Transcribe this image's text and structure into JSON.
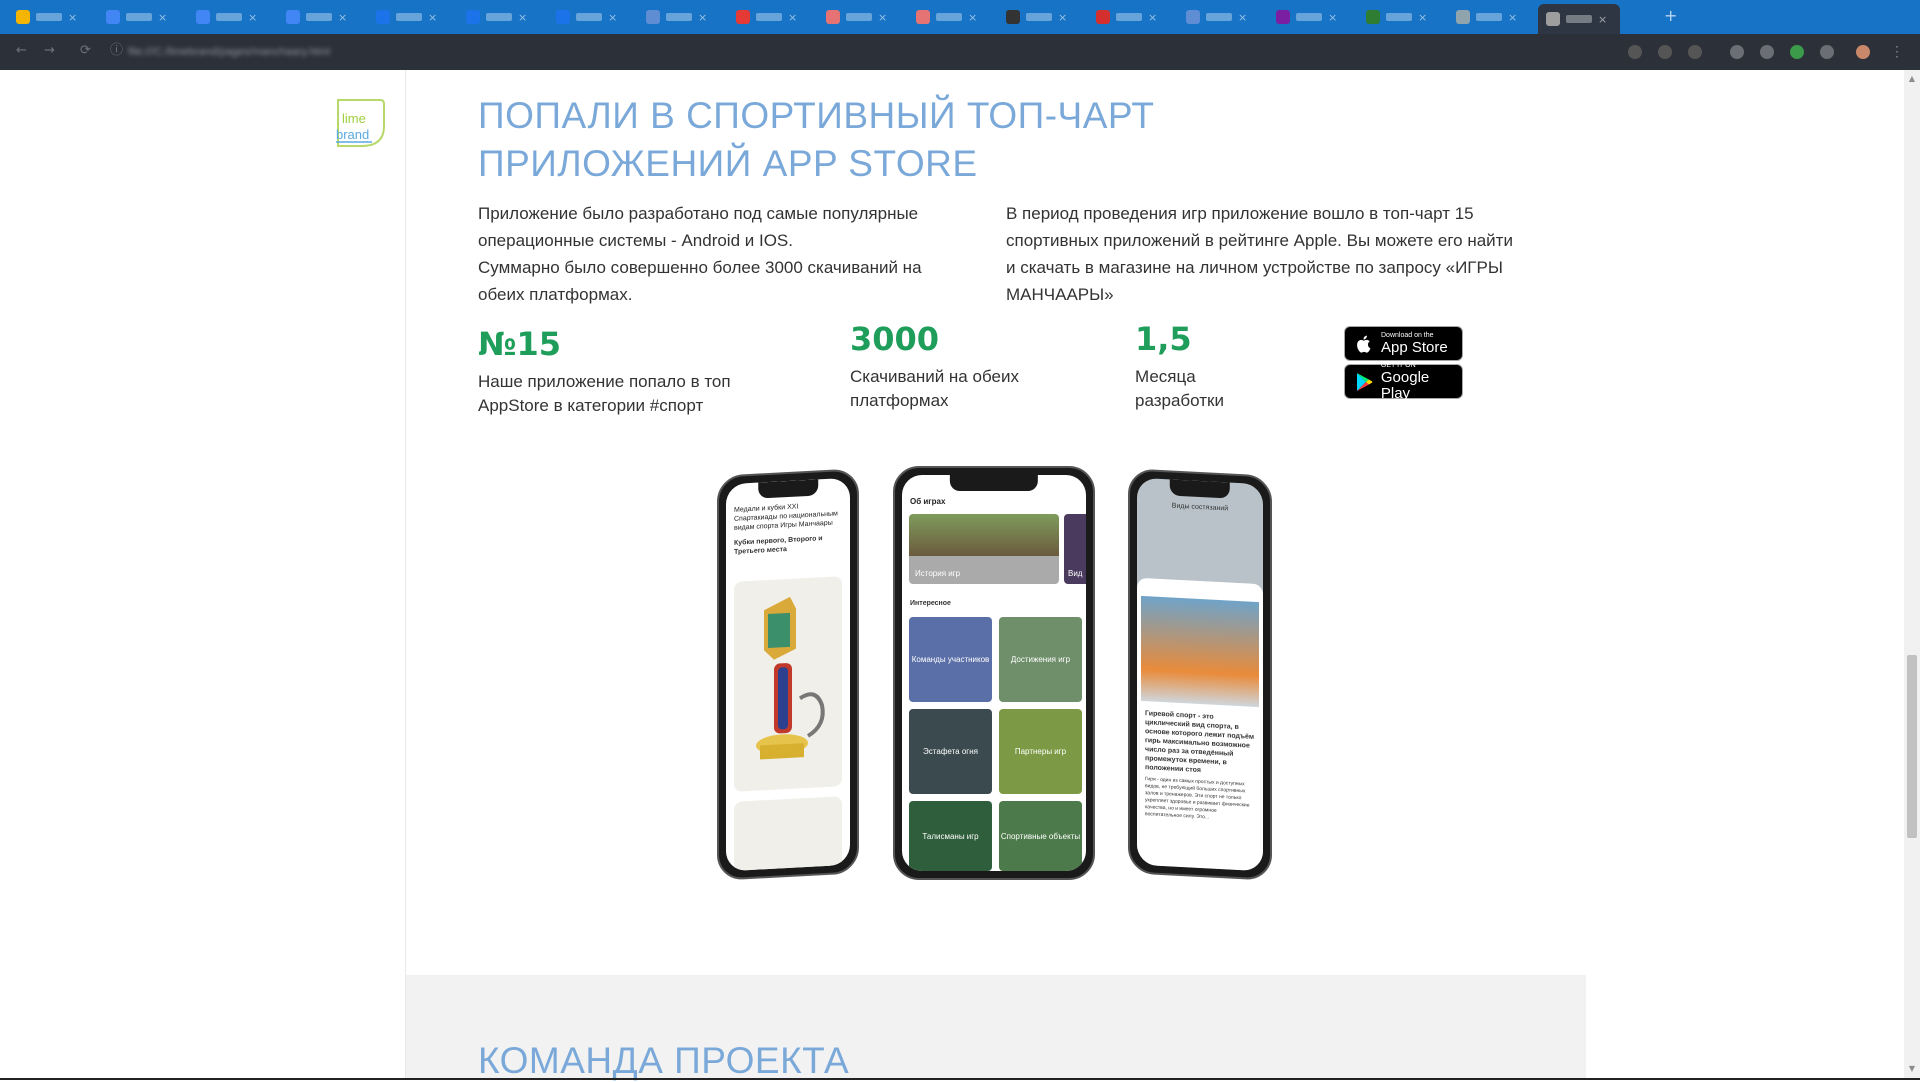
{
  "browser": {
    "tabs": [
      {
        "color": "#f4b400"
      },
      {
        "color": "#4285f4"
      },
      {
        "color": "#4285f4"
      },
      {
        "color": "#4285f4"
      },
      {
        "color": "#1a73e8"
      },
      {
        "color": "#1a73e8"
      },
      {
        "color": "#1a73e8"
      },
      {
        "color": "#5f8dd3"
      },
      {
        "color": "#e53935"
      },
      {
        "color": "#e57373"
      },
      {
        "color": "#e57373"
      },
      {
        "color": "#333333"
      },
      {
        "color": "#d32f2f"
      },
      {
        "color": "#5f8dd3"
      },
      {
        "color": "#7b1fa2"
      },
      {
        "color": "#2e7d32"
      },
      {
        "color": "#90a4ae"
      },
      {
        "color": "#9e9e9e"
      }
    ],
    "new_tab_label": "+",
    "url": "file:///C:/limebrand/pages/manchaary.html"
  },
  "logo": {
    "line1": "lime",
    "line2": "brand"
  },
  "section": {
    "heading_line1": "ПОПАЛИ В СПОРТИВНЫЙ ТОП-ЧАРТ",
    "heading_line2": "ПРИЛОЖЕНИЙ APP STORE",
    "para_left_1": "Приложение было разработано под самые популярные операционные системы - Android и IOS.",
    "para_left_2": "Суммарно было совершенно более 3000 скачиваний на обеих платформах.",
    "para_right": "В период проведения игр приложение вошло в топ-чарт 15 спортивных приложений в рейтинге Apple. Вы можете его найти и скачать в магазине на личном устройстве по запросу «ИГРЫ МАНЧААРЫ»"
  },
  "stats": [
    {
      "value": "№15",
      "desc": "Наше приложение попало в топ AppStore в категории #спорт"
    },
    {
      "value": "3000",
      "desc": "Скачиваний на обеих платформах"
    },
    {
      "value": "1,5",
      "desc": "Месяца разработки"
    }
  ],
  "badges": {
    "appstore_small": "Download on the",
    "appstore_big": "App Store",
    "google_small": "GET IT ON",
    "google_big": "Google Play"
  },
  "phone_left": {
    "title": "Медали и кубки XXI Спартакиады по национальным видам спорта Игры Манчаары",
    "subtitle": "Кубки первого, Второго и Третьего места"
  },
  "phone_center": {
    "title": "Об играх",
    "hero_label": "История игр",
    "hero_next": "Вид",
    "section": "Интересное",
    "tiles": [
      "Команды участников",
      "Достижения игр",
      "Эстафета огня",
      "Партнеры игр",
      "Талисманы игр",
      "Спортивные объекты"
    ]
  },
  "phone_right": {
    "header": "Виды состязаний",
    "headline": "Гиревой спорт - это циклический вид спорта, в основе которого лежит подъём гирь максимально возможное число раз за отведённый промежуток времени, в положении стоя",
    "body": "Гиря - один из самых простых и доступных видов, не требующий больших спортивных залов и тренажеров. Эти спорт не только укрепляет здоровье и развивает физические качества, но и имеет огромное воспитательное силу. Это..."
  },
  "team_heading": "КОМАНДА ПРОЕКТА",
  "colors": {
    "accent_green": "#1e9e5a",
    "heading_blue": "#7aa9d9",
    "tabbar": "#1673c5"
  }
}
